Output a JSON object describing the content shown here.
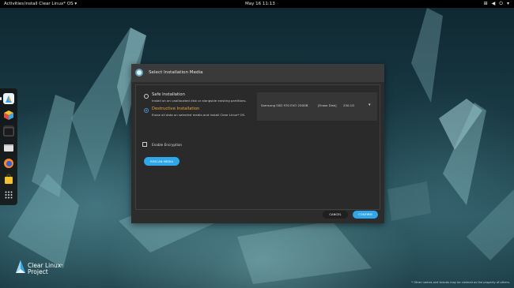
{
  "topbar": {
    "activities": "Activities",
    "app_menu": "Install Clear Linux* OS",
    "clock": "May 16  11:13"
  },
  "dock": {
    "items": [
      {
        "name": "Install Clear Linux OS",
        "icon": "clear-linux-installer-icon"
      },
      {
        "name": "Software",
        "icon": "software-cube-icon"
      },
      {
        "name": "Terminal",
        "icon": "terminal-icon"
      },
      {
        "name": "Files",
        "icon": "files-icon"
      },
      {
        "name": "Firefox",
        "icon": "firefox-icon"
      },
      {
        "name": "Software Center",
        "icon": "store-bag-icon"
      },
      {
        "name": "Show Applications",
        "icon": "app-grid-icon"
      }
    ]
  },
  "dialog": {
    "title": "Select Installation Media",
    "safe": {
      "title": "Safe Installation",
      "desc": "Install on an unallocated disk or alongside existing partitions."
    },
    "destructive": {
      "title": "Destructive Installation",
      "desc": "Erase all data on selected media and install Clear Linux* OS."
    },
    "disk": {
      "name": "Samsung SSD 970 EVO 250GB",
      "action": "[Erase Disk]",
      "size": "250.1G"
    },
    "encryption_label": "Enable Encryption",
    "rescan_label": "RESCAN MEDIA",
    "cancel_label": "CANCEL",
    "confirm_label": "CONFIRM"
  },
  "branding": {
    "line1": "Clear Linux",
    "sup": "*",
    "line2": "Project"
  },
  "footnote": "* Other names and brands may be claimed as the property of others.",
  "colors": {
    "accent": "#2fa7e8",
    "destructive": "#f2a23a",
    "dialog_bg": "#2c2c2c",
    "header_bg": "#3a3a3a"
  }
}
